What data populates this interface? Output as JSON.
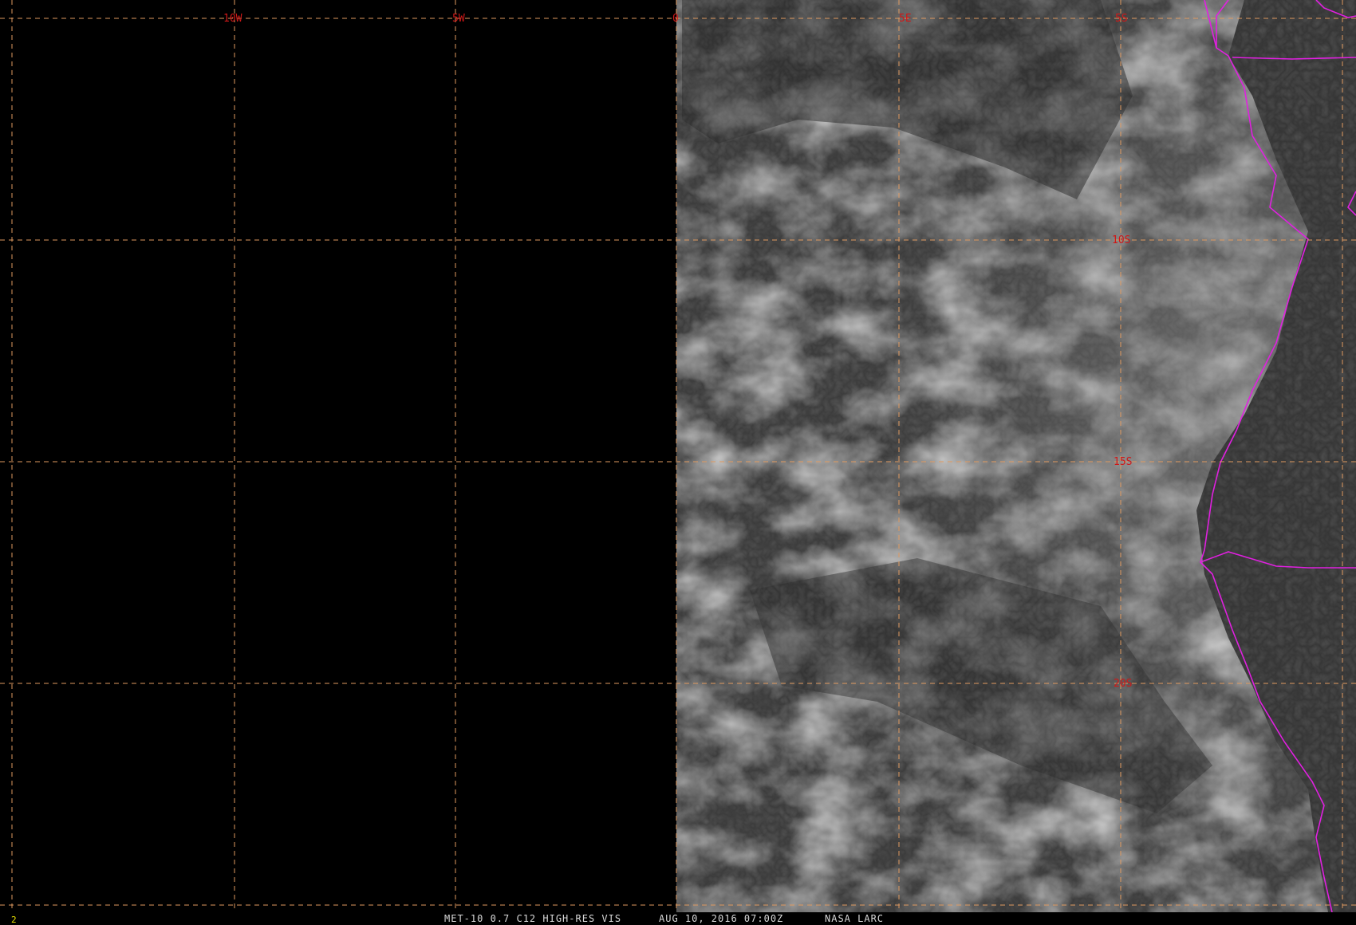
{
  "colors": {
    "background": "#000000",
    "grid_line": "#e09a60",
    "grid_label": "#d01818",
    "coastline": "#e020e0",
    "status_text": "#d8d8d8",
    "frame_number": "#e8e000"
  },
  "grid": {
    "longitude_labels": [
      "10W",
      "5W",
      "0",
      "5E",
      "5S"
    ],
    "latitude_labels": [
      "10S",
      "15S",
      "20S"
    ]
  },
  "status_bar": {
    "frame_number": "2",
    "product": "MET-10 0.7 C12 HIGH-RES VIS",
    "datetime": "AUG 10, 2016 07:00Z",
    "source": "NASA LARC"
  }
}
